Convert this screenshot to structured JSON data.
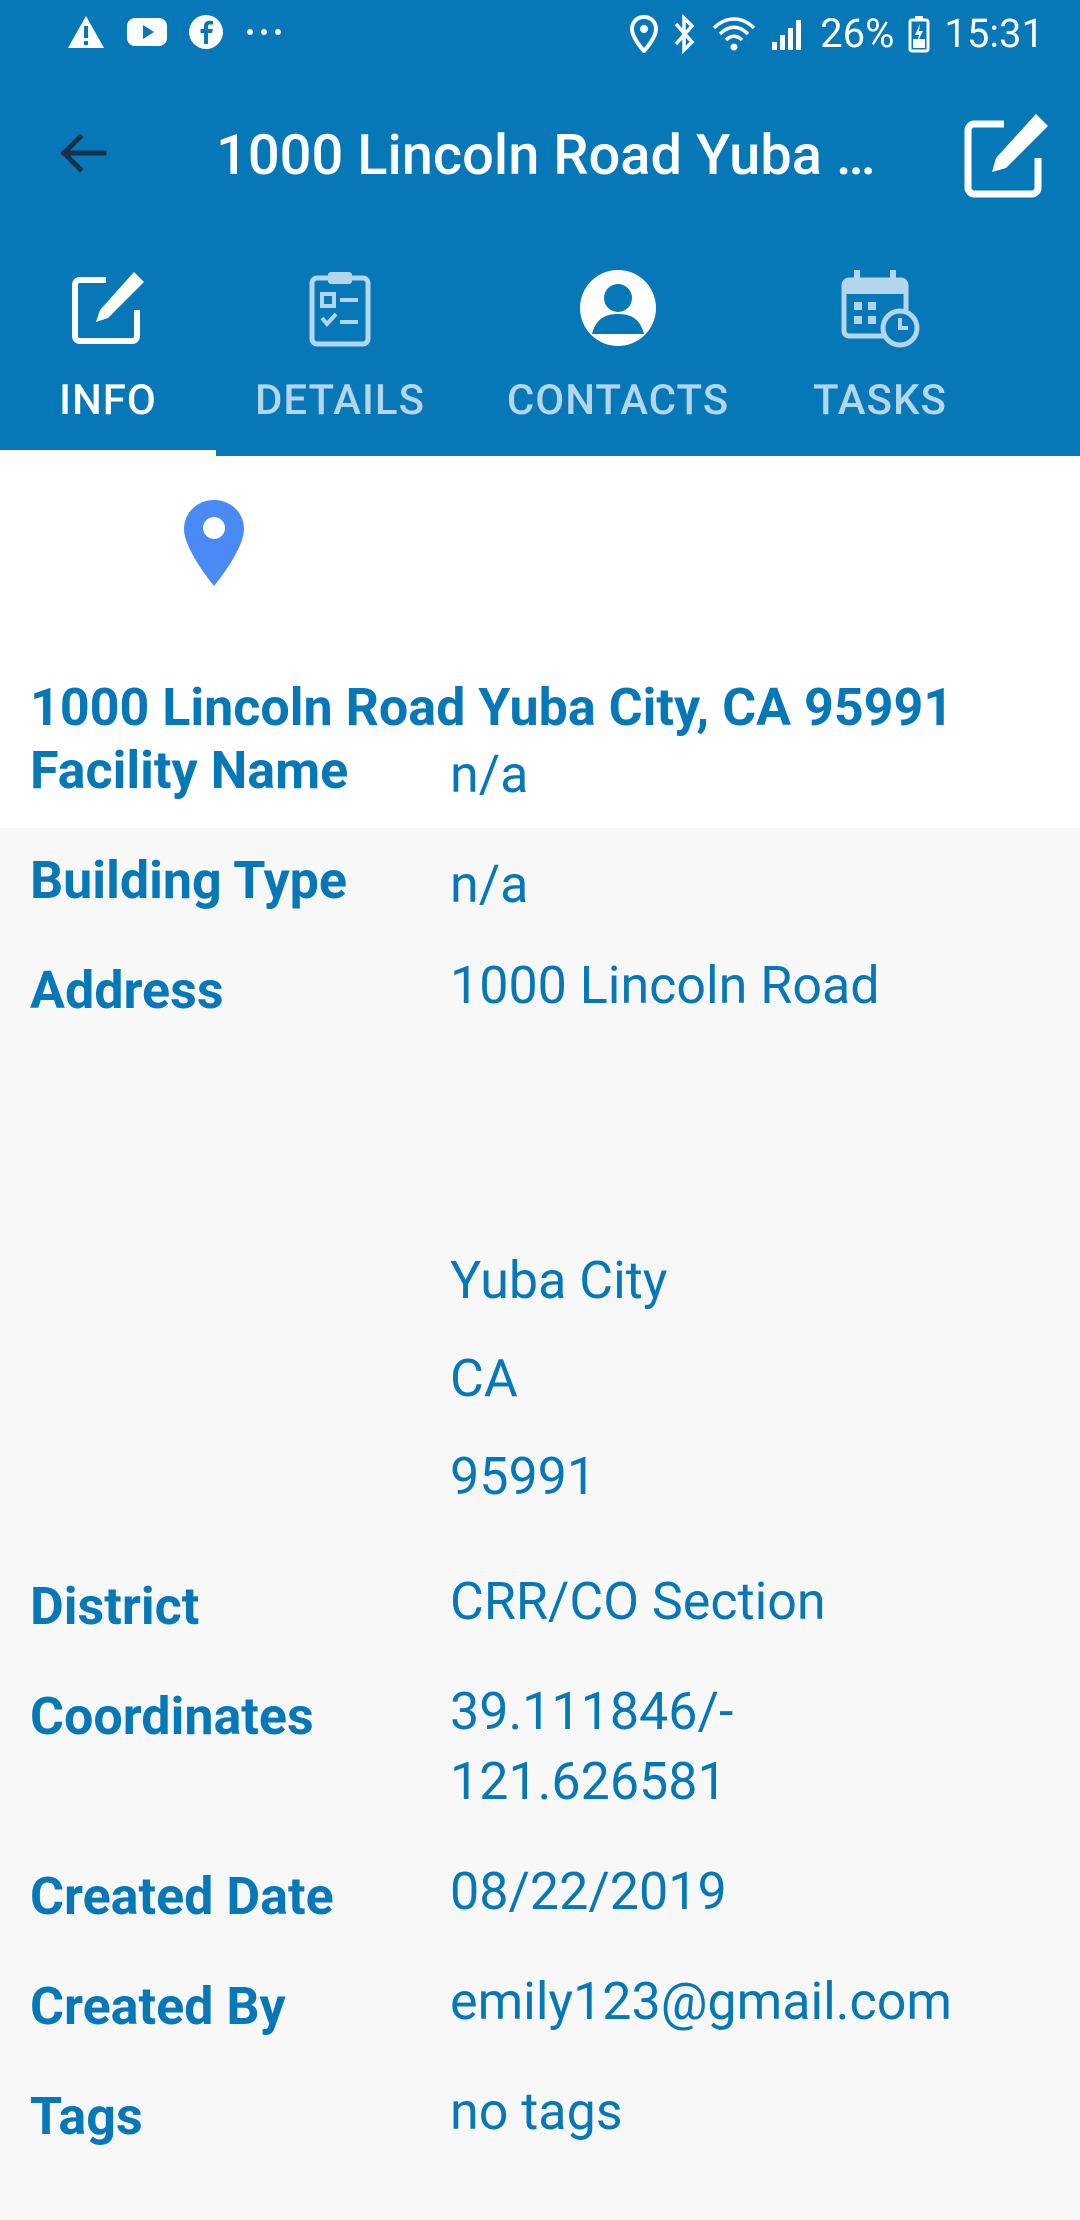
{
  "status_bar": {
    "battery": "26%",
    "time": "15:31"
  },
  "toolbar": {
    "title": "1000 Lincoln Road  Yuba City, CA 95991"
  },
  "tabs": [
    {
      "label": "INFO",
      "icon": "edit-icon",
      "active": true
    },
    {
      "label": "DETAILS",
      "icon": "clipboard-icon",
      "active": false
    },
    {
      "label": "CONTACTS",
      "icon": "person-icon",
      "active": false
    },
    {
      "label": "TASKS",
      "icon": "calendar-clock-icon",
      "active": false
    }
  ],
  "header": {
    "heading": "1000 Lincoln Road  Yuba City, CA 95991"
  },
  "details": {
    "facility_name": {
      "label": "Facility Name",
      "value": "n/a"
    },
    "building_type": {
      "label": "Building Type",
      "value": "n/a"
    },
    "address": {
      "label": "Address",
      "line1": "1000 Lincoln Road",
      "city": "Yuba City",
      "state": "CA",
      "zip": "95991"
    },
    "district": {
      "label": "District",
      "value": "CRR/CO Section"
    },
    "coordinates": {
      "label": "Coordinates",
      "line1": "39.111846/-",
      "line2": "121.626581"
    },
    "created_date": {
      "label": "Created Date",
      "value": "08/22/2019"
    },
    "created_by": {
      "label": "Created By",
      "value": "emily123@gmail.com"
    },
    "tags": {
      "label": "Tags",
      "value": "no tags"
    }
  },
  "colors": {
    "primary": "#0678b8",
    "pin": "#4a8af4"
  }
}
